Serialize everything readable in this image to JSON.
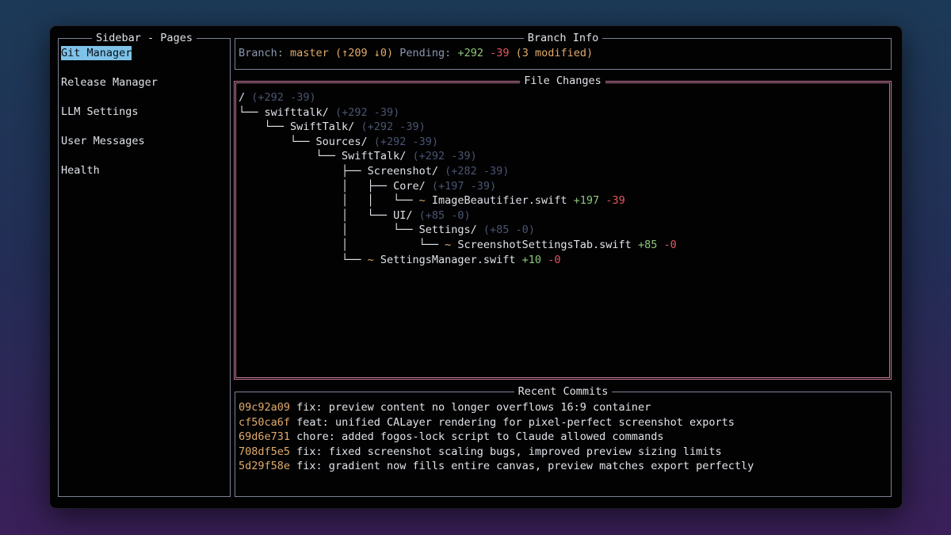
{
  "sidebar": {
    "title": "Sidebar - Pages",
    "items": [
      {
        "label": "Git Manager",
        "active": true
      },
      {
        "label": "Release Manager",
        "active": false
      },
      {
        "label": "LLM Settings",
        "active": false
      },
      {
        "label": "User Messages",
        "active": false
      },
      {
        "label": "Health",
        "active": false
      }
    ]
  },
  "branch_info": {
    "title": "Branch Info",
    "branch_label": "Branch:",
    "branch_name": "master",
    "ahead_behind": "(↑209 ↓0)",
    "pending_label": "Pending:",
    "pending_add": "+292",
    "pending_del": "-39",
    "pending_modified": "(3 modified)"
  },
  "file_changes": {
    "title": "File Changes",
    "tree": [
      {
        "prefix": "",
        "name": "/",
        "add": "+292",
        "del": "-39",
        "file": false
      },
      {
        "prefix": "└── ",
        "name": "swifttalk/",
        "add": "+292",
        "del": "-39",
        "file": false
      },
      {
        "prefix": "    └── ",
        "name": "SwiftTalk/",
        "add": "+292",
        "del": "-39",
        "file": false
      },
      {
        "prefix": "        └── ",
        "name": "Sources/",
        "add": "+292",
        "del": "-39",
        "file": false
      },
      {
        "prefix": "            └── ",
        "name": "SwiftTalk/",
        "add": "+292",
        "del": "-39",
        "file": false
      },
      {
        "prefix": "                ├── ",
        "name": "Screenshot/",
        "add": "+282",
        "del": "-39",
        "file": false
      },
      {
        "prefix": "                │   ├── ",
        "name": "Core/",
        "add": "+197",
        "del": "-39",
        "file": false
      },
      {
        "prefix": "                │   │   └── ",
        "name": "ImageBeautifier.swift",
        "add": "+197",
        "del": "-39",
        "file": true
      },
      {
        "prefix": "                │   └── ",
        "name": "UI/",
        "add": "+85",
        "del": "-0",
        "file": false
      },
      {
        "prefix": "                │       └── ",
        "name": "Settings/",
        "add": "+85",
        "del": "-0",
        "file": false
      },
      {
        "prefix": "                │           └── ",
        "name": "ScreenshotSettingsTab.swift",
        "add": "+85",
        "del": "-0",
        "file": true
      },
      {
        "prefix": "                └── ",
        "name": "SettingsManager.swift",
        "add": "+10",
        "del": "-0",
        "file": true
      }
    ],
    "modified_marker": "~ "
  },
  "recent_commits": {
    "title": "Recent Commits",
    "commits": [
      {
        "hash": "09c92a09",
        "message": "fix: preview content no longer overflows 16:9 container"
      },
      {
        "hash": "cf50ca6f",
        "message": "feat: unified CALayer rendering for pixel-perfect screenshot exports"
      },
      {
        "hash": "69d6e731",
        "message": "chore: added fogos-lock script to Claude allowed commands"
      },
      {
        "hash": "708df5e5",
        "message": "fix: fixed screenshot scaling bugs, improved preview sizing limits"
      },
      {
        "hash": "5d29f58e",
        "message": "fix: gradient now fills entire canvas, preview matches export perfectly"
      }
    ]
  },
  "colors": {
    "active_item_bg": "#7fc2e8",
    "add": "#8dc77a",
    "del": "#e4585e",
    "accent": "#e0ab6a",
    "focused_border": "#c07896"
  }
}
